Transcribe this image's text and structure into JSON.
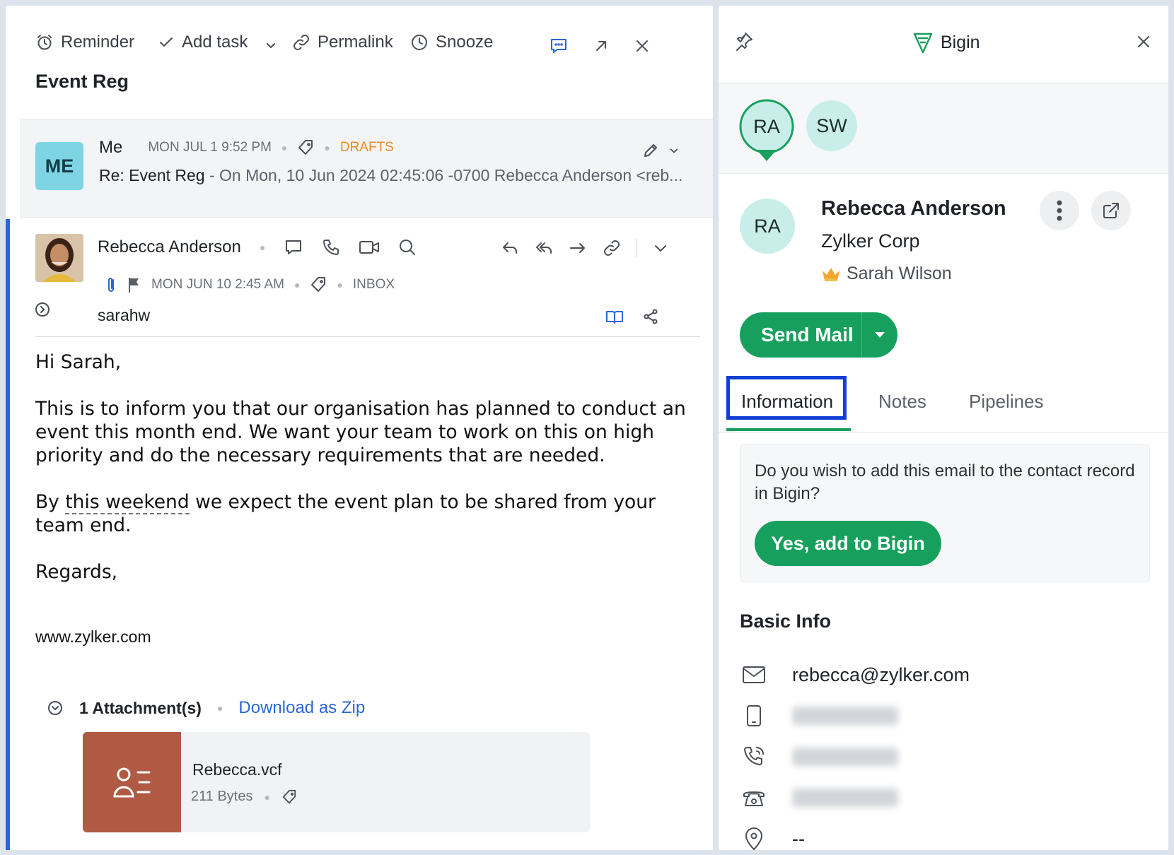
{
  "toolbar": {
    "reminder": "Reminder",
    "add_task": "Add task",
    "permalink": "Permalink",
    "snooze": "Snooze"
  },
  "subject": "Event Reg",
  "draft": {
    "avatar": "ME",
    "sender": "Me",
    "date": "MON JUL 1 9:52 PM",
    "folder": "DRAFTS",
    "folder_color": "#f08a1c",
    "subject": "Re: Event Reg",
    "preview": "- On Mon, 10 Jun 2024 02:45:06 -0700 Rebecca Anderson <reb..."
  },
  "message": {
    "sender": "Rebecca Anderson",
    "date": "MON JUN 10 2:45 AM",
    "folder": "INBOX",
    "to": "sarahw",
    "body": {
      "greeting": "Hi Sarah,",
      "para1": "This is to inform you that our organisation has planned to conduct an event this month end. We want your team to work on this on high priority and do the necessary requirements that are needed.",
      "para2_pre": "By ",
      "para2_link": "this weekend",
      "para2_post": " we expect the event plan to be shared from your team end.",
      "regards": "Regards,",
      "signature": "www.zylker.com"
    },
    "attachments": {
      "count_label": "1 Attachment(s)",
      "download_label": "Download as Zip",
      "file_name": "Rebecca.vcf",
      "file_size": "211 Bytes"
    }
  },
  "bigin": {
    "title": "Bigin",
    "avatars": [
      "RA",
      "SW"
    ],
    "contact": {
      "initials": "RA",
      "name": "Rebecca Anderson",
      "company": "Zylker Corp",
      "owner": "Sarah Wilson"
    },
    "send_mail": "Send Mail",
    "tabs": [
      "Information",
      "Notes",
      "Pipelines"
    ],
    "active_tab": "Information",
    "prompt": {
      "text": "Do you wish to add this email to the contact record in Bigin?",
      "button": "Yes, add to Bigin"
    },
    "basic_info": {
      "title": "Basic Info",
      "email": "rebecca@zylker.com",
      "address": "--"
    },
    "brand_color": "#17a05d"
  }
}
